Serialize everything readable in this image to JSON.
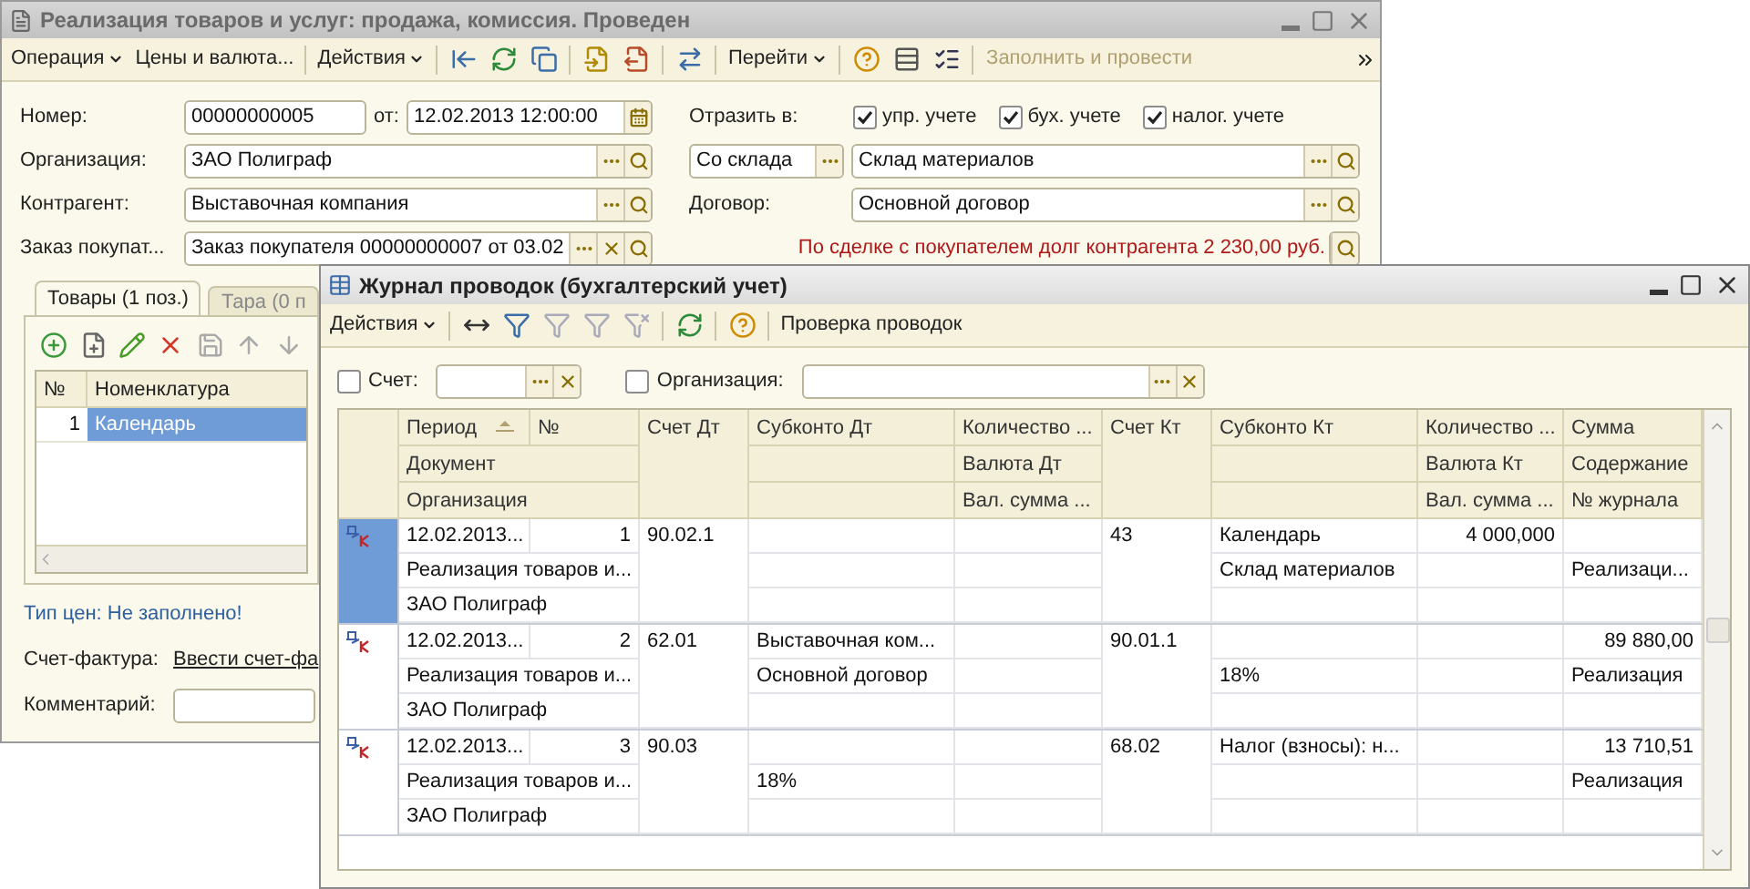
{
  "main_window": {
    "title": "Реализация товаров и услуг: продажа, комиссия. Проведен",
    "toolbar": {
      "items": [
        {
          "kind": "menu",
          "label": "Операция"
        },
        {
          "kind": "button",
          "label": "Цены и валюта..."
        }
      ],
      "actions_menu": "Действия",
      "goto_menu": "Перейти",
      "fill_button": {
        "label": "Заполнить и провести",
        "disabled": true
      }
    },
    "number": {
      "label": "Номер:",
      "value": "00000000005"
    },
    "date": {
      "label": "от:",
      "value": "12.02.2013 12:00:00"
    },
    "organization": {
      "label": "Организация:",
      "value": "ЗАО Полиграф"
    },
    "counterparty": {
      "label": "Контрагент:",
      "value": "Выставочная компания"
    },
    "order": {
      "label": "Заказ покупат...",
      "value": "Заказ покупателя 00000000007 от 03.02"
    },
    "reflect": {
      "label": "Отразить в:",
      "options": [
        {
          "label": "упр. учете",
          "checked": true
        },
        {
          "label": "бух. учете",
          "checked": true
        },
        {
          "label": "налог. учете",
          "checked": true
        }
      ]
    },
    "warehouse_type": "Со склада",
    "warehouse": "Склад материалов",
    "contract": {
      "label": "Договор:",
      "value": "Основной договор"
    },
    "debt_notice": "По сделке с покупателем долг контрагента 2 230,00 руб.",
    "tabs": [
      {
        "label": "Товары (1 поз.)",
        "selected": true
      },
      {
        "label": "Тара (0 п",
        "selected": false
      }
    ],
    "goods_table": {
      "columns": [
        "№",
        "Номенклатура"
      ],
      "rows": [
        {
          "number": "1",
          "item": "Календарь",
          "selected": true
        }
      ]
    },
    "price_type": "Тип цен: Не заполнено!",
    "invoice": {
      "label": "Счет-фактура:",
      "link": "Ввести счет-фа"
    },
    "comment": {
      "label": "Комментарий:"
    }
  },
  "journal_window": {
    "title": "Журнал проводок (бухгалтерский учет)",
    "toolbar": {
      "actions_menu": "Действия",
      "check_button": "Проверка проводок"
    },
    "filters": [
      {
        "label": "Счет:",
        "checked": false
      },
      {
        "label": "Организация:",
        "checked": false
      }
    ],
    "header": {
      "period": "Период",
      "number": "№",
      "document": "Документ",
      "organization": "Организация",
      "account_dt": "Счет Дт",
      "subconto_dt": "Субконто Дт",
      "quantity_dt": "Количество ...",
      "currency_dt": "Валюта Дт",
      "currency_sum_dt": "Вал. сумма ...",
      "account_kt": "Счет Кт",
      "subconto_kt": "Субконто Кт",
      "quantity_kt": "Количество ...",
      "currency_kt": "Валюта Кт",
      "currency_sum_kt": "Вал. сумма ...",
      "sum": "Сумма",
      "content": "Содержание",
      "journal_no": "№ журнала"
    },
    "rows": [
      {
        "selected": true,
        "period": "12.02.2013...",
        "number": "1",
        "document": "Реализация товаров и...",
        "organization": "ЗАО Полиграф",
        "account_dt": "90.02.1",
        "account_kt": "43",
        "subconto_kt_1": "Календарь",
        "subconto_kt_2": "Склад материалов",
        "quantity_kt": "4 000,000",
        "content": "Реализаци..."
      },
      {
        "selected": false,
        "period": "12.02.2013...",
        "number": "2",
        "document": "Реализация товаров и...",
        "organization": "ЗАО Полиграф",
        "account_dt": "62.01",
        "subconto_dt_1": "Выставочная ком...",
        "subconto_dt_2": "Основной договор",
        "account_kt": "90.01.1",
        "subconto_kt_2": "18%",
        "sum": "89 880,00",
        "content": "Реализация"
      },
      {
        "selected": false,
        "period": "12.02.2013...",
        "number": "3",
        "document": "Реализация товаров и...",
        "organization": "ЗАО Полиграф",
        "account_dt": "90.03",
        "subconto_dt_2": "18%",
        "account_kt": "68.02",
        "subconto_kt_1": "Налог (взносы): н...",
        "sum": "13 710,51",
        "content": "Реализация"
      }
    ]
  }
}
